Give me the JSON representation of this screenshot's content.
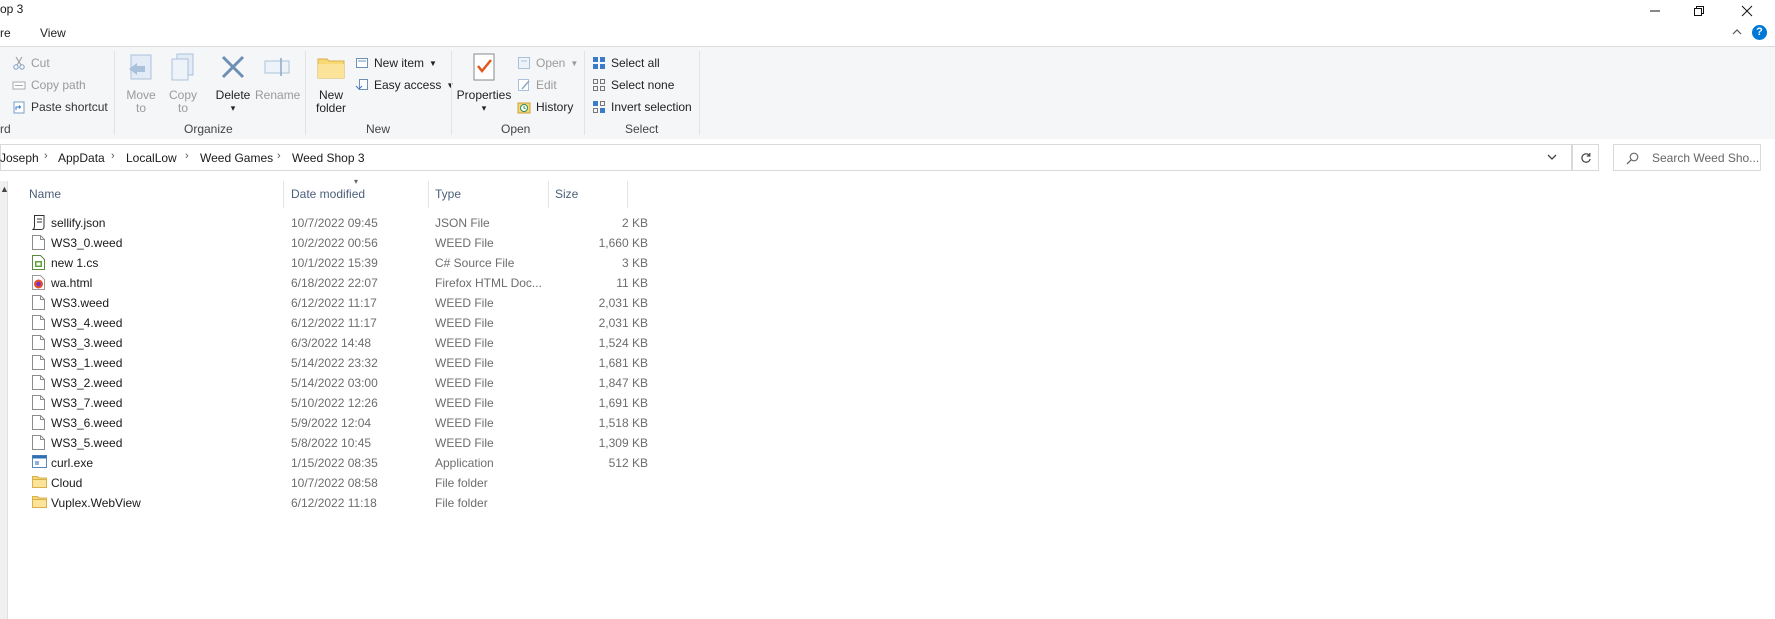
{
  "window": {
    "title": "op 3",
    "minimize_icon": "minimize-icon",
    "restore_icon": "restore-icon",
    "close_icon": "close-icon"
  },
  "ribbon_tabs": {
    "share": "re",
    "view": "View"
  },
  "ribbon": {
    "clipboard": {
      "cut": "Cut",
      "copy_path": "Copy path",
      "paste_shortcut": "Paste shortcut",
      "label": "rd"
    },
    "organize": {
      "move_to": [
        "Move",
        "to"
      ],
      "copy_to": [
        "Copy",
        "to"
      ],
      "delete": "Delete",
      "rename": "Rename",
      "label": "Organize"
    },
    "new": {
      "new_folder": [
        "New",
        "folder"
      ],
      "new_item": "New item",
      "easy_access": "Easy access",
      "label": "New"
    },
    "open": {
      "properties": "Properties",
      "open": "Open",
      "edit": "Edit",
      "history": "History",
      "label": "Open"
    },
    "select": {
      "select_all": "Select all",
      "select_none": "Select none",
      "invert_selection": "Invert selection",
      "label": "Select"
    }
  },
  "address": {
    "breadcrumbs": [
      "Joseph",
      "AppData",
      "LocalLow",
      "Weed Games",
      "Weed Shop 3"
    ],
    "search_placeholder": "Search Weed Sho..."
  },
  "columns": {
    "name": "Name",
    "date_modified": "Date modified",
    "type": "Type",
    "size": "Size"
  },
  "files": [
    {
      "name": "sellify.json",
      "date": "10/7/2022 09:45",
      "type": "JSON File",
      "size": "2 KB",
      "icon": "json-file-icon"
    },
    {
      "name": "WS3_0.weed",
      "date": "10/2/2022 00:56",
      "type": "WEED File",
      "size": "1,660 KB",
      "icon": "file-icon"
    },
    {
      "name": "new 1.cs",
      "date": "10/1/2022 15:39",
      "type": "C# Source File",
      "size": "3 KB",
      "icon": "cs-file-icon"
    },
    {
      "name": "wa.html",
      "date": "6/18/2022 22:07",
      "type": "Firefox HTML Doc...",
      "size": "11 KB",
      "icon": "firefox-html-icon"
    },
    {
      "name": "WS3.weed",
      "date": "6/12/2022 11:17",
      "type": "WEED File",
      "size": "2,031 KB",
      "icon": "file-icon"
    },
    {
      "name": "WS3_4.weed",
      "date": "6/12/2022 11:17",
      "type": "WEED File",
      "size": "2,031 KB",
      "icon": "file-icon"
    },
    {
      "name": "WS3_3.weed",
      "date": "6/3/2022 14:48",
      "type": "WEED File",
      "size": "1,524 KB",
      "icon": "file-icon"
    },
    {
      "name": "WS3_1.weed",
      "date": "5/14/2022 23:32",
      "type": "WEED File",
      "size": "1,681 KB",
      "icon": "file-icon"
    },
    {
      "name": "WS3_2.weed",
      "date": "5/14/2022 03:00",
      "type": "WEED File",
      "size": "1,847 KB",
      "icon": "file-icon"
    },
    {
      "name": "WS3_7.weed",
      "date": "5/10/2022 12:26",
      "type": "WEED File",
      "size": "1,691 KB",
      "icon": "file-icon"
    },
    {
      "name": "WS3_6.weed",
      "date": "5/9/2022 12:04",
      "type": "WEED File",
      "size": "1,518 KB",
      "icon": "file-icon"
    },
    {
      "name": "WS3_5.weed",
      "date": "5/8/2022 10:45",
      "type": "WEED File",
      "size": "1,309 KB",
      "icon": "file-icon"
    },
    {
      "name": "curl.exe",
      "date": "1/15/2022 08:35",
      "type": "Application",
      "size": "512 KB",
      "icon": "application-icon"
    },
    {
      "name": "Cloud",
      "date": "10/7/2022 08:58",
      "type": "File folder",
      "size": "",
      "icon": "folder-icon"
    },
    {
      "name": "Vuplex.WebView",
      "date": "6/12/2022 11:18",
      "type": "File folder",
      "size": "",
      "icon": "folder-icon"
    }
  ],
  "colors": {
    "accent": "#0078d7",
    "header_text": "#4c607a",
    "ribbon_bg": "#f5f6f7",
    "folder": "#f8d775"
  }
}
